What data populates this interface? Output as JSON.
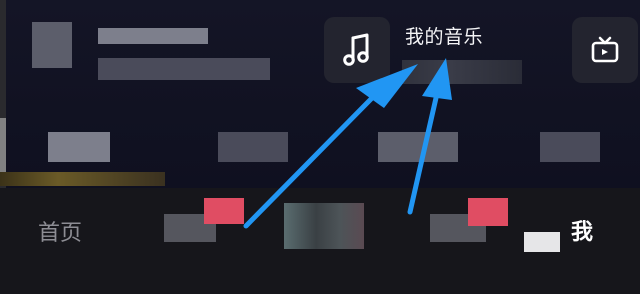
{
  "header": {
    "my_music_label": "我的音乐"
  },
  "bottom_nav": {
    "tabs": [
      {
        "label": "首页"
      },
      {
        "label": "我"
      }
    ]
  },
  "icons": {
    "music": "music-note-icon",
    "tv": "tv-icon"
  },
  "colors": {
    "background": "#0e0e16",
    "tab_bar": "#16161b",
    "arrow": "#2196f3",
    "badge_pink": "#e04d63",
    "inactive_tab": "#8d8d94"
  }
}
